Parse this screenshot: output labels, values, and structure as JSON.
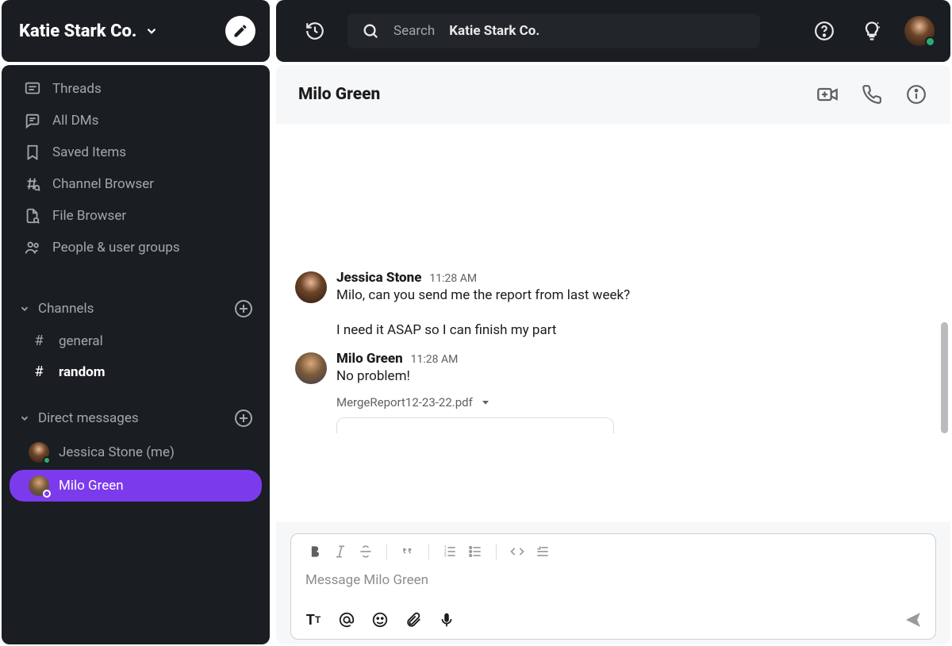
{
  "workspace": {
    "name": "Katie Stark Co."
  },
  "search": {
    "label": "Search",
    "scope": "Katie Stark Co."
  },
  "sidebar": {
    "nav": [
      {
        "label": "Threads",
        "icon": "threads-icon"
      },
      {
        "label": "All DMs",
        "icon": "dms-icon"
      },
      {
        "label": "Saved Items",
        "icon": "bookmark-icon"
      },
      {
        "label": "Channel Browser",
        "icon": "channel-browser-icon"
      },
      {
        "label": "File Browser",
        "icon": "file-browser-icon"
      },
      {
        "label": "People & user groups",
        "icon": "people-icon"
      }
    ],
    "channels_label": "Channels",
    "channels": [
      {
        "name": "general",
        "bold": false
      },
      {
        "name": "random",
        "bold": true
      }
    ],
    "dms_label": "Direct messages",
    "dms": [
      {
        "name": "Jessica Stone (me)",
        "active": false,
        "presence": "online"
      },
      {
        "name": "Milo Green",
        "active": true,
        "presence": "away"
      }
    ]
  },
  "conversation": {
    "title": "Milo Green",
    "messages": [
      {
        "author": "Jessica Stone",
        "time": "11:28 AM",
        "lines": [
          "Milo, can you send me the report from last week?",
          "I need it ASAP so I can finish my part"
        ]
      },
      {
        "author": "Milo Green",
        "time": "11:28 AM",
        "lines": [
          "No problem!"
        ],
        "attachment": "MergeReport12-23-22.pdf"
      }
    ],
    "composer_placeholder": "Message Milo Green"
  }
}
